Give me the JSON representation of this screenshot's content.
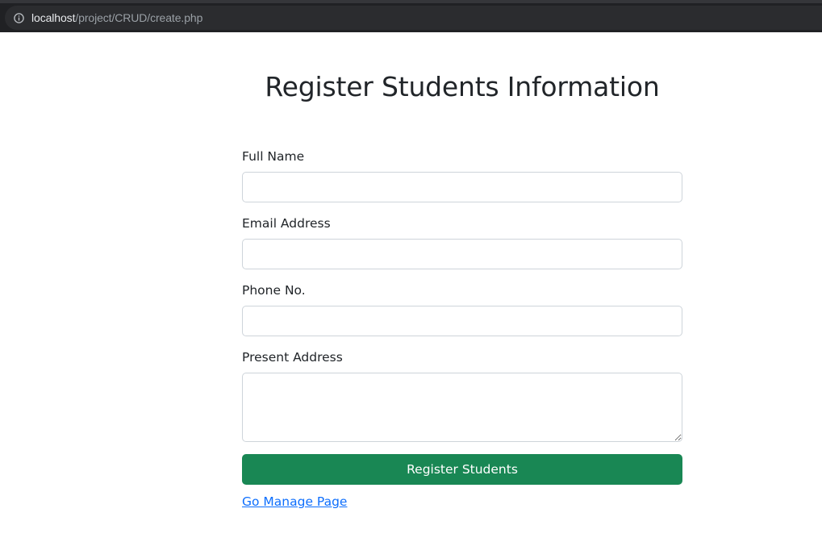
{
  "browser": {
    "url_host": "localhost",
    "url_path": "/project/CRUD/create.php",
    "info_icon": "info-circle-icon"
  },
  "page": {
    "title": "Register Students Information"
  },
  "form": {
    "full_name_label": "Full Name",
    "full_name_value": "",
    "email_label": "Email Address",
    "email_value": "",
    "phone_label": "Phone No.",
    "phone_value": "",
    "address_label": "Present Address",
    "address_value": "",
    "submit_label": "Register Students",
    "manage_link": "Go Manage Page"
  },
  "colors": {
    "submit_bg": "#198754",
    "link": "#0d6efd",
    "browser_bar": "#202124"
  }
}
